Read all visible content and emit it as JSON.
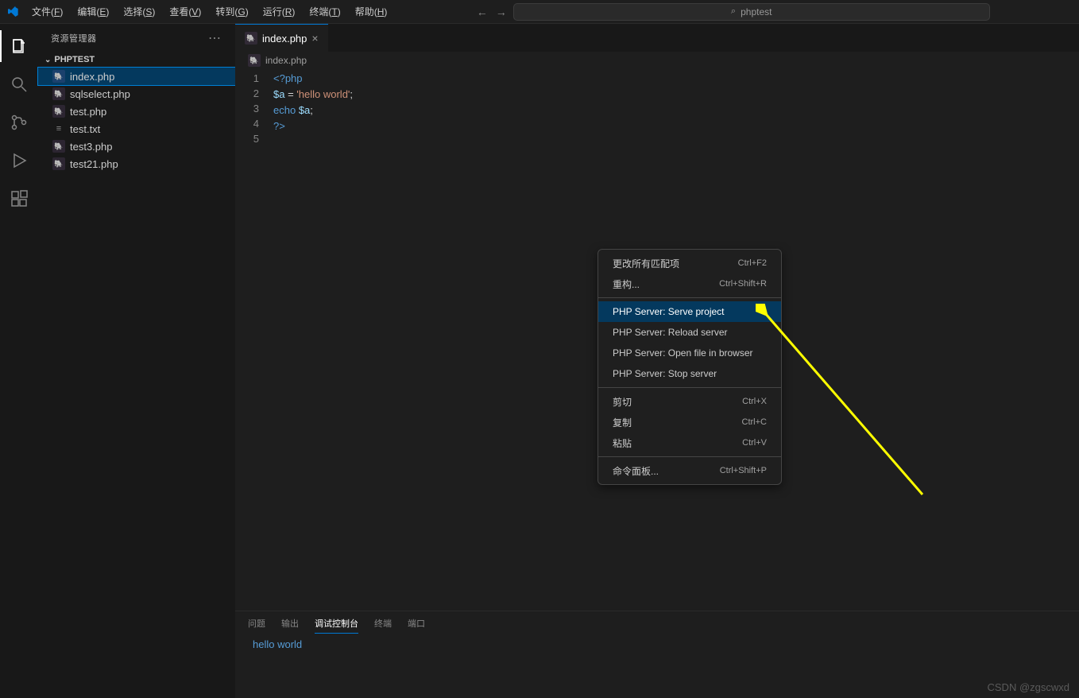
{
  "titlebar": {
    "menus": [
      "文件(F)",
      "编辑(E)",
      "选择(S)",
      "查看(V)",
      "转到(G)",
      "运行(R)",
      "终端(T)",
      "帮助(H)"
    ],
    "search_text": "phptest"
  },
  "sidebar": {
    "title": "资源管理器",
    "project": "PHPTEST",
    "files": [
      {
        "name": "index.php",
        "icon": "php",
        "selected": true
      },
      {
        "name": "sqlselect.php",
        "icon": "php",
        "selected": false
      },
      {
        "name": "test.php",
        "icon": "php",
        "selected": false
      },
      {
        "name": "test.txt",
        "icon": "txt",
        "selected": false
      },
      {
        "name": "test3.php",
        "icon": "php",
        "selected": false
      },
      {
        "name": "test21.php",
        "icon": "php",
        "selected": false
      }
    ]
  },
  "editor": {
    "tab_name": "index.php",
    "breadcrumb": "index.php",
    "lines": [
      "1",
      "2",
      "3",
      "4",
      "5"
    ],
    "code": {
      "l1": "<?php",
      "l2_var": "$a",
      "l2_eq": " = ",
      "l2_str": "'hello world'",
      "l2_semi": ";",
      "l3_echo": "echo ",
      "l3_var": "$a",
      "l3_semi": ";",
      "l4": "?>"
    }
  },
  "context_menu": {
    "items": [
      {
        "label": "更改所有匹配项",
        "shortcut": "Ctrl+F2"
      },
      {
        "label": "重构...",
        "shortcut": "Ctrl+Shift+R"
      },
      {
        "sep": true
      },
      {
        "label": "PHP Server: Serve project",
        "shortcut": "",
        "hover": true
      },
      {
        "label": "PHP Server: Reload server",
        "shortcut": ""
      },
      {
        "label": "PHP Server: Open file in browser",
        "shortcut": ""
      },
      {
        "label": "PHP Server: Stop server",
        "shortcut": ""
      },
      {
        "sep": true
      },
      {
        "label": "剪切",
        "shortcut": "Ctrl+X"
      },
      {
        "label": "复制",
        "shortcut": "Ctrl+C"
      },
      {
        "label": "粘贴",
        "shortcut": "Ctrl+V"
      },
      {
        "sep": true
      },
      {
        "label": "命令面板...",
        "shortcut": "Ctrl+Shift+P"
      }
    ]
  },
  "panel": {
    "tabs": [
      "问题",
      "输出",
      "调试控制台",
      "终端",
      "端口"
    ],
    "active_tab": 2,
    "output": "hello world"
  },
  "watermark": "CSDN @zgscwxd"
}
